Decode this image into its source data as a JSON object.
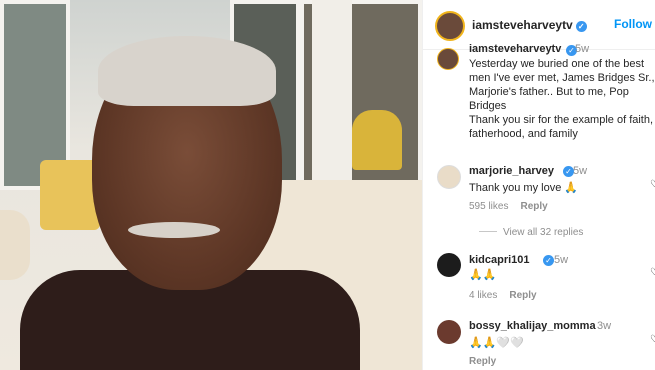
{
  "post": {
    "username": "iamsteveharveytv",
    "follow_label": "Follow",
    "verified_glyph": "✓"
  },
  "caption": {
    "username": "iamsteveharveytv",
    "time": "5w",
    "text_lines": [
      "Yesterday we buried one of the best",
      "men I've ever met, James Bridges Sr.,",
      "Marjorie's father.. But to me, Pop",
      "Bridges",
      "Thank you sir for the example of faith,",
      "fatherhood, and family"
    ]
  },
  "comments": [
    {
      "username": "marjorie_harvey",
      "time": "5w",
      "text": "Thank you my love 🙏",
      "likes": "595 likes",
      "reply_label": "Reply",
      "verified": true
    },
    {
      "username": "kidcapri101",
      "time": "5w",
      "text": "🙏🙏",
      "likes": "4 likes",
      "reply_label": "Reply",
      "verified": true
    },
    {
      "username": "bossy_khalijay_momma",
      "time": "3w",
      "text": "🙏🙏🤍🤍",
      "reply_label": "Reply",
      "verified": false
    }
  ],
  "view_replies": "View all 32 replies",
  "icons": {
    "heart": "heart-outline-icon",
    "verified": "verified-badge-icon"
  },
  "colors": {
    "accent": "#0095f6",
    "verified": "#3897f0",
    "muted": "#8e8e8e",
    "text": "#262626"
  }
}
